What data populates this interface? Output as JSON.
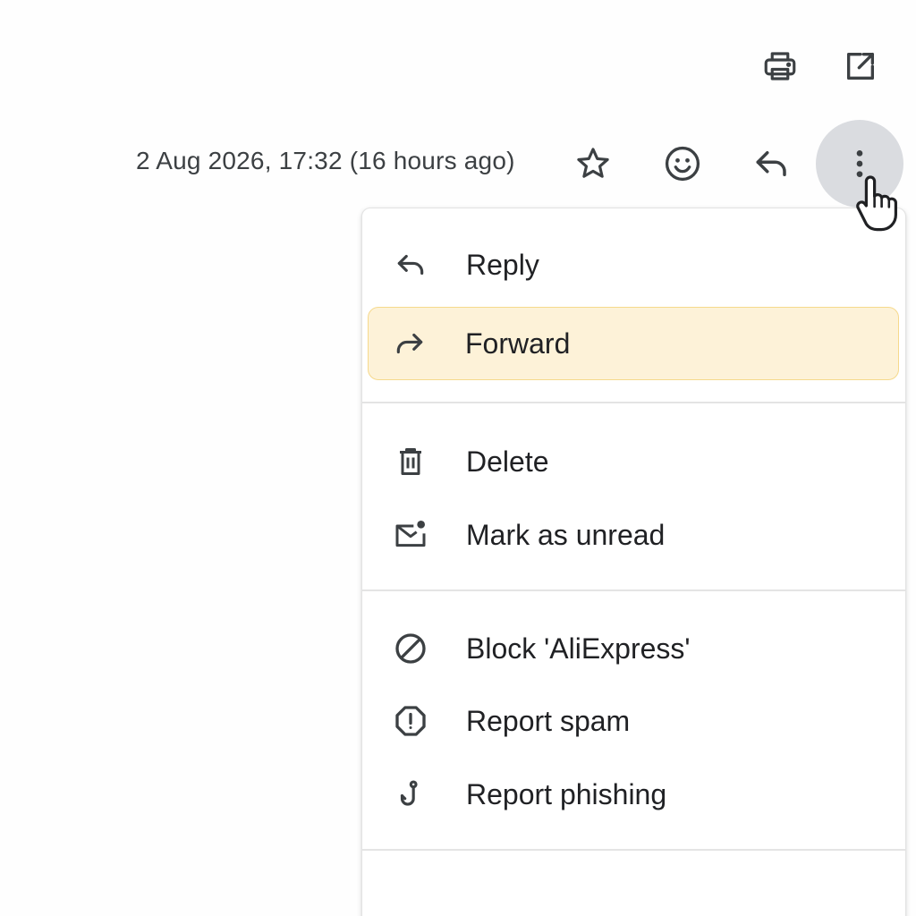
{
  "toolbar": {
    "print_icon": "print-icon",
    "open_new_window_icon": "open-in-new-icon"
  },
  "message_header": {
    "timestamp": "2 Aug 2026, 17:32 (16 hours ago)",
    "actions": [
      "star-icon",
      "emoji-icon",
      "reply-icon",
      "more-vert-icon"
    ]
  },
  "menu": {
    "items": [
      {
        "label": "Reply",
        "icon": "reply-icon"
      },
      {
        "label": "Forward",
        "icon": "forward-icon",
        "highlighted": true
      },
      {
        "label": "Delete",
        "icon": "trash-icon"
      },
      {
        "label": "Mark as unread",
        "icon": "mark-unread-icon"
      },
      {
        "label": "Block 'AliExpress'",
        "icon": "block-icon"
      },
      {
        "label": "Report spam",
        "icon": "report-spam-icon"
      },
      {
        "label": "Report phishing",
        "icon": "phishing-hook-icon"
      }
    ]
  },
  "colors": {
    "highlight_bg": "#fdf2d8",
    "highlight_border": "#f6d98c",
    "more_button_bg": "#dadce0",
    "text": "#202124"
  }
}
